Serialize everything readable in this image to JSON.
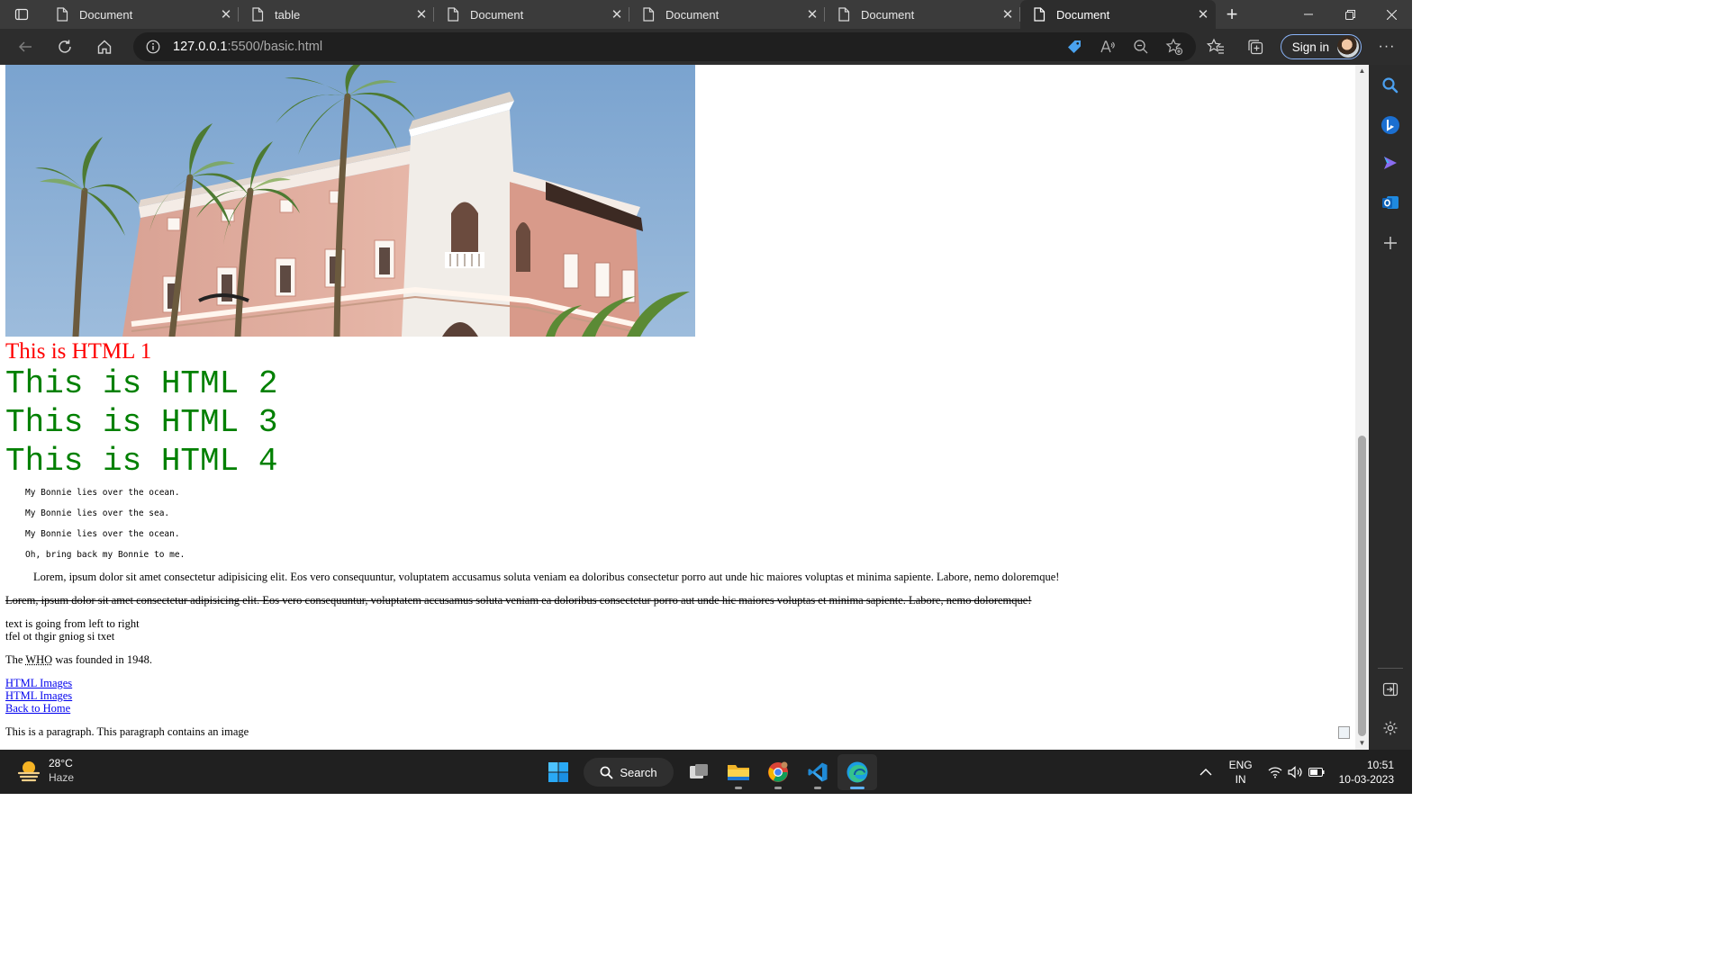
{
  "browser": {
    "tabs": [
      {
        "title": "Document",
        "active": false
      },
      {
        "title": "table",
        "active": false
      },
      {
        "title": "Document",
        "active": false
      },
      {
        "title": "Document",
        "active": false
      },
      {
        "title": "Document",
        "active": false
      },
      {
        "title": "Document",
        "active": true
      }
    ],
    "address": {
      "host": "127.0.0.1",
      "path": ":5500/basic.html"
    },
    "sign_in_label": "Sign in"
  },
  "page": {
    "heading_red": "This is HTML 1",
    "mono_headings": [
      "This is HTML 2",
      "This is HTML 3",
      "This is HTML 4"
    ],
    "poem_lines": [
      "My Bonnie lies over the ocean.",
      "My Bonnie lies over the sea.",
      "My Bonnie lies over the ocean.",
      "Oh, bring back my Bonnie to me."
    ],
    "lorem_indented": "Lorem, ipsum dolor sit amet consectetur adipisicing elit. Eos vero consequuntur, voluptatem accusamus soluta veniam ea doloribus consectetur porro aut unde hic maiores voluptas et minima sapiente. Labore, nemo doloremque!",
    "lorem_struck": "Lorem, ipsum dolor sit amet consectetur adipisicing elit. Eos vero consequuntur, voluptatem accusamus soluta veniam ea doloribus consectetur porro aut unde hic maiores voluptas et minima sapiente. Labore, nemo doloremque!",
    "ltr_text": "text is going from left to right",
    "rtl_text": "tfel ot thgir gniog si txet",
    "who": {
      "before": "The ",
      "abbr": "WHO",
      "after": " was founded in 1948."
    },
    "links": [
      "HTML Images",
      "HTML Images",
      "Back to Home"
    ],
    "last_paragraph": "This is a paragraph. This paragraph contains an image"
  },
  "taskbar": {
    "weather": {
      "temp": "28°C",
      "condition": "Haze"
    },
    "search_label": "Search",
    "lang": {
      "line1": "ENG",
      "line2": "IN"
    },
    "clock": {
      "time": "10:51",
      "date": "10-03-2023"
    }
  },
  "colors": {
    "heading_red": "#ff0000",
    "heading_green": "#008000",
    "link_blue": "#0000ee",
    "tabbar_bg": "#3b3b3b",
    "toolbar_bg": "#2d2d2d",
    "taskbar_bg": "#202020"
  }
}
